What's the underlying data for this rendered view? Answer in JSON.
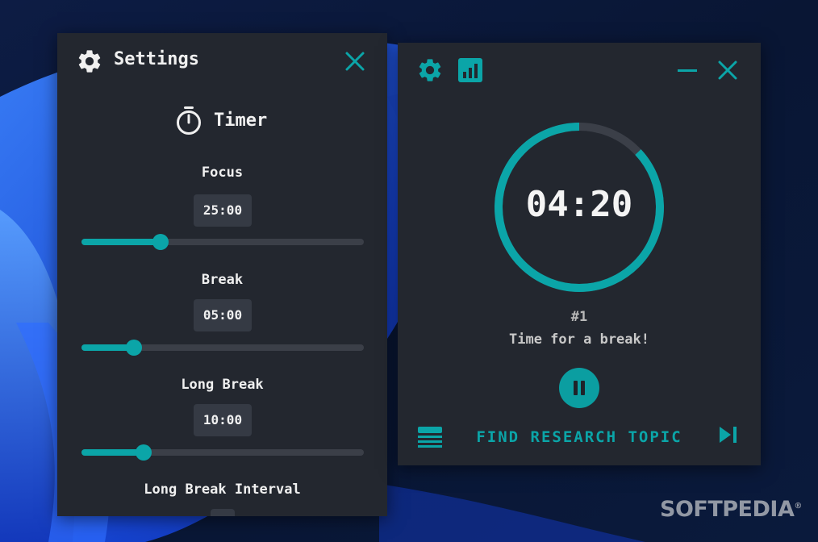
{
  "colors": {
    "accent": "#0ba5a8",
    "panel_bg": "#23272f",
    "track": "#3b3f48",
    "value_box": "#353a44"
  },
  "settings": {
    "title": "Settings",
    "section_title": "Timer",
    "icons": {
      "header": "gear-icon",
      "close": "close-icon",
      "section": "stopwatch-icon"
    },
    "focus": {
      "label": "Focus",
      "value": "25:00",
      "slider_fraction": 0.28
    },
    "break": {
      "label": "Break",
      "value": "05:00",
      "slider_fraction": 0.185
    },
    "long_break": {
      "label": "Long Break",
      "value": "10:00",
      "slider_fraction": 0.22
    },
    "long_break_interval": {
      "label": "Long Break Interval"
    }
  },
  "timer": {
    "icons": {
      "settings": "gear-icon",
      "stats": "bar-chart-icon",
      "minimize": "minimize-icon",
      "close": "close-icon",
      "tasks": "list-icon",
      "skip": "skip-next-icon",
      "pause": "pause-icon"
    },
    "time": "04:20",
    "progress_remaining": 0.87,
    "round": "#1",
    "message": "Time for a break!",
    "task": "FIND RESEARCH TOPIC"
  },
  "watermark": {
    "text": "SOFTPEDIA",
    "mark": "®"
  }
}
